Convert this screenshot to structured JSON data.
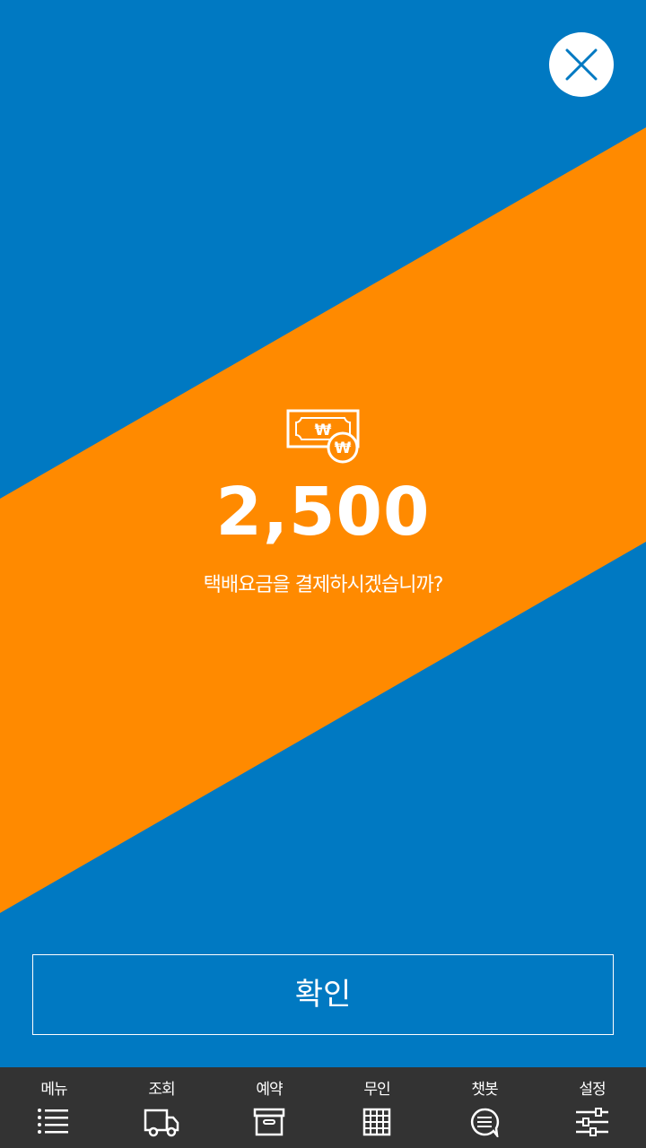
{
  "colors": {
    "background": "#0079c2",
    "band": "#ff8a00",
    "tabbar": "#333333",
    "text": "#ffffff"
  },
  "dialog": {
    "close_icon": "close-icon",
    "money_icon": "won-banknote-icon",
    "amount": "2,500",
    "question": "택배요금을 결제하시겠습니까?",
    "confirm_label": "확인"
  },
  "tabbar": {
    "items": [
      {
        "label": "메뉴",
        "icon": "list-icon"
      },
      {
        "label": "조회",
        "icon": "truck-icon"
      },
      {
        "label": "예약",
        "icon": "box-icon"
      },
      {
        "label": "무인",
        "icon": "grid-icon"
      },
      {
        "label": "챗봇",
        "icon": "chat-bubble-icon"
      },
      {
        "label": "설정",
        "icon": "sliders-icon"
      }
    ]
  }
}
